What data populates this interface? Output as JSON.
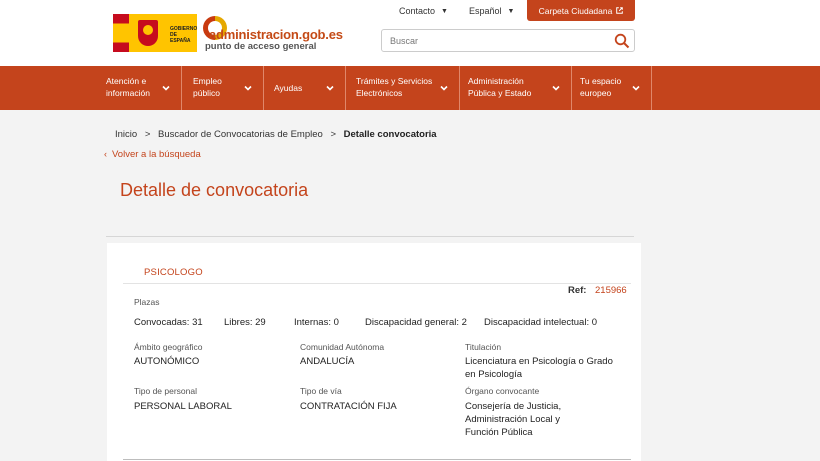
{
  "header": {
    "escudo_text": "GOBIERNO DE ESPAÑA",
    "brand_name": "administracion.gob.es",
    "brand_tagline": "punto de acceso general",
    "contacto_label": "Contacto",
    "language_label": "Español",
    "carpeta_label": "Carpeta Ciudadana",
    "search_placeholder": "Buscar"
  },
  "mainnav": [
    {
      "label": "Atención e información"
    },
    {
      "label": "Empleo público"
    },
    {
      "label": "Ayudas"
    },
    {
      "label": "Trámites y Servicios Electrónicos"
    },
    {
      "label": "Administración Pública y Estado"
    },
    {
      "label": "Tu espacio europeo"
    }
  ],
  "breadcrumb": {
    "inicio": "Inicio",
    "buscador": "Buscador de Convocatorias de Empleo",
    "current": "Detalle convocatoria",
    "separator": ">"
  },
  "back_label": "Volver a la búsqueda",
  "page_title": "Detalle de convocatoria",
  "convocatoria": {
    "kind": "PSICOLOGO",
    "ref_label": "Ref:",
    "ref_value": "215966",
    "plazas_label": "Plazas",
    "convocadas": "Convocadas: 31",
    "libres": "Libres: 29",
    "internas": "Internas: 0",
    "disc_general": "Discapacidad general: 2",
    "disc_intelectual": "Discapacidad intelectual: 0",
    "ambito_label": "Ámbito geográfico",
    "ambito_value": "AUTONÓMICO",
    "comunidad_label": "Comunidad Autónoma",
    "comunidad_value": "ANDALUCÍA",
    "titulacion_label": "Titulación",
    "titulacion_value": "Licenciatura en Psicología o Grado en Psicología",
    "tipo_personal_label": "Tipo de personal",
    "tipo_personal_value": "PERSONAL LABORAL",
    "tipo_via_label": "Tipo de vía",
    "tipo_via_value": "CONTRATACIÓN FIJA",
    "organo_label": "Órgano convocante",
    "organo_value": "Consejería de Justicia, Administración Local y Función Pública"
  },
  "colors": {
    "accent": "#c4441c",
    "background": "#f3f3f3"
  }
}
